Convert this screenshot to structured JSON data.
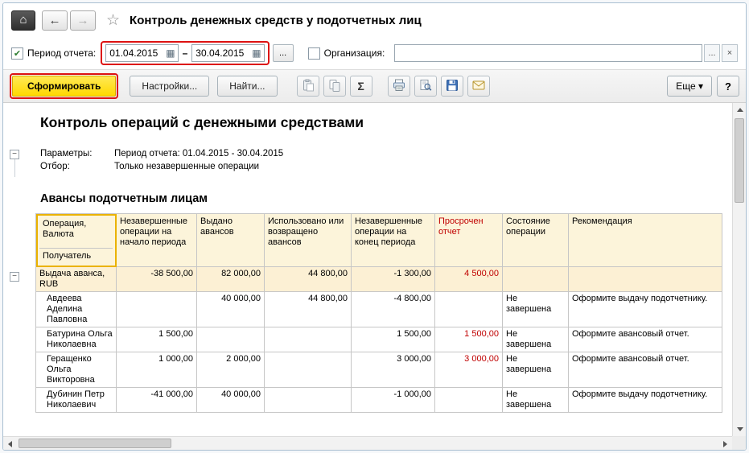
{
  "colors": {
    "accent_yellow": "#ffd800",
    "highlight_red": "#dd1111",
    "overdue_red": "#c00000",
    "table_header_bg": "#fcf4da",
    "group_row_bg": "#fcf0d4",
    "selected_header_outline": "#eab200"
  },
  "icons": {
    "home": "⌂",
    "back": "←",
    "forward": "→",
    "star": "☆",
    "check": "✔",
    "calendar": "▦",
    "dropdown": "▾",
    "minus": "−"
  },
  "titlebar": {
    "title": "Контроль денежных средств у подотчетных лиц"
  },
  "filters": {
    "period": {
      "label": "Период отчета:",
      "from": "01.04.2015",
      "to": "30.04.2015",
      "separator": "–",
      "picker_button": "..."
    },
    "organization": {
      "label": "Организация:",
      "value": "",
      "picker_button": "...",
      "clear_button": "×"
    }
  },
  "toolbar": {
    "generate": "Сформировать",
    "settings": "Настройки...",
    "find": "Найти...",
    "sigma": "Σ",
    "more": "Еще",
    "help": "?"
  },
  "report": {
    "title": "Контроль операций с денежными средствами",
    "parameters_label": "Параметры:",
    "parameters_value": "Период отчета: 01.04.2015 - 30.04.2015",
    "filter_label": "Отбор:",
    "filter_value": "Только незавершенные операции",
    "section_title": "Авансы подотчетным лицам"
  },
  "table": {
    "headers": {
      "col0_line1": "Операция, Валюта",
      "col0_line2": "Получатель",
      "col1": "Незавершенные операции на начало периода",
      "col2": "Выдано авансов",
      "col3": "Использовано или возвращено авансов",
      "col4": "Незавершенные операции на конец периода",
      "col5": "Просрочен отчет",
      "col6": "Состояние операции",
      "col7": "Рекомендация"
    },
    "rows": [
      {
        "name": "Выдача аванса, RUB",
        "start": "-38 500,00",
        "issued": "82 000,00",
        "used": "44 800,00",
        "end": "-1 300,00",
        "overdue": "4 500,00",
        "status": "",
        "recommendation": ""
      },
      {
        "name": "Авдеева Аделина Павловна",
        "start": "",
        "issued": "40 000,00",
        "used": "44 800,00",
        "end": "-4 800,00",
        "overdue": "",
        "status": "Не завершена",
        "recommendation": "Оформите выдачу подотчетнику."
      },
      {
        "name": "Батурина Ольга Николаевна",
        "start": "1 500,00",
        "issued": "",
        "used": "",
        "end": "1 500,00",
        "overdue": "1 500,00",
        "status": "Не завершена",
        "recommendation": "Оформите авансовый отчет."
      },
      {
        "name": "Геращенко Ольга Викторовна",
        "start": "1 000,00",
        "issued": "2 000,00",
        "used": "",
        "end": "3 000,00",
        "overdue": "3 000,00",
        "status": "Не завершена",
        "recommendation": "Оформите авансовый отчет."
      },
      {
        "name": "Дубинин Петр Николаевич",
        "start": "-41 000,00",
        "issued": "40 000,00",
        "used": "",
        "end": "-1 000,00",
        "overdue": "",
        "status": "Не завершена",
        "recommendation": "Оформите выдачу подотчетнику."
      }
    ]
  }
}
